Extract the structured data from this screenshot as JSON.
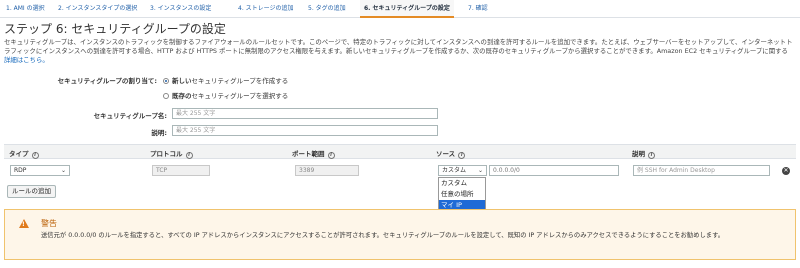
{
  "wizard_tabs": [
    {
      "label": "1. AMI の選択"
    },
    {
      "label": "2. インスタンスタイプの選択"
    },
    {
      "label": "3. インスタンスの設定"
    },
    {
      "label": "4. ストレージの追加"
    },
    {
      "label": "5. タグの追加"
    },
    {
      "label": "6. セキュリティグループの設定"
    },
    {
      "label": "7. 確認"
    }
  ],
  "active_tab_index": 5,
  "page_title": "ステップ 6: セキュリティグループの設定",
  "description": {
    "text": "セキュリティグループは、インスタンスのトラフィックを制御するファイアウォールのルールセットです。このページで、特定のトラフィックに対してインスタンスへの到達を許可するルールを追加できます。たとえば、ウェブサーバーをセットアップして、インターネットトラフィックにインスタンスへの到達を許可する場合、HTTP および HTTPS ポートに無制限のアクセス権限を与えます。新しいセキュリティグループを作成するか、次の既存のセキュリティグループから選択することができます。Amazon EC2 セキュリティグループに関する",
    "link": "詳細はこちら。"
  },
  "assignment": {
    "label": "セキュリティグループの割り当て:",
    "options": [
      {
        "bold": "新しい",
        "rest": "セキュリティグループを作成する",
        "checked": true
      },
      {
        "bold": "既存の",
        "rest": "セキュリティグループを選択する",
        "checked": false
      }
    ]
  },
  "group_name": {
    "label": "セキュリティグループ名:",
    "placeholder": "最大 255 文字"
  },
  "group_desc": {
    "label": "説明:",
    "placeholder": "最大 255 文字"
  },
  "table": {
    "headers": {
      "type": "タイプ",
      "protocol": "プロトコル",
      "port": "ポート範囲",
      "source": "ソース",
      "description": "説明"
    },
    "row": {
      "type": "RDP",
      "protocol": "TCP",
      "port": "3389",
      "source_select": "カスタム",
      "source_value": "0.0.0.0/0",
      "description_placeholder": "例 SSH for Admin Desktop"
    }
  },
  "source_dropdown": {
    "options": [
      "カスタム",
      "任意の場所",
      "マイ IP"
    ],
    "highlighted_index": 2
  },
  "add_rule_label": "ルールの追加",
  "warning": {
    "title": "警告",
    "text": "送信元が 0.0.0.0/0 のルールを指定すると、すべての IP アドレスからインスタンスにアクセスすることが許可されます。セキュリティグループのルールを設定して、既知の IP アドレスからのみアクセスできるようにすることをお勧めします。"
  },
  "colors": {
    "accent": "#e48b25",
    "link": "#1166bb",
    "warning_bg": "#fef6e9",
    "warning_border": "#f0c36d",
    "selected": "#1f6ad6"
  }
}
